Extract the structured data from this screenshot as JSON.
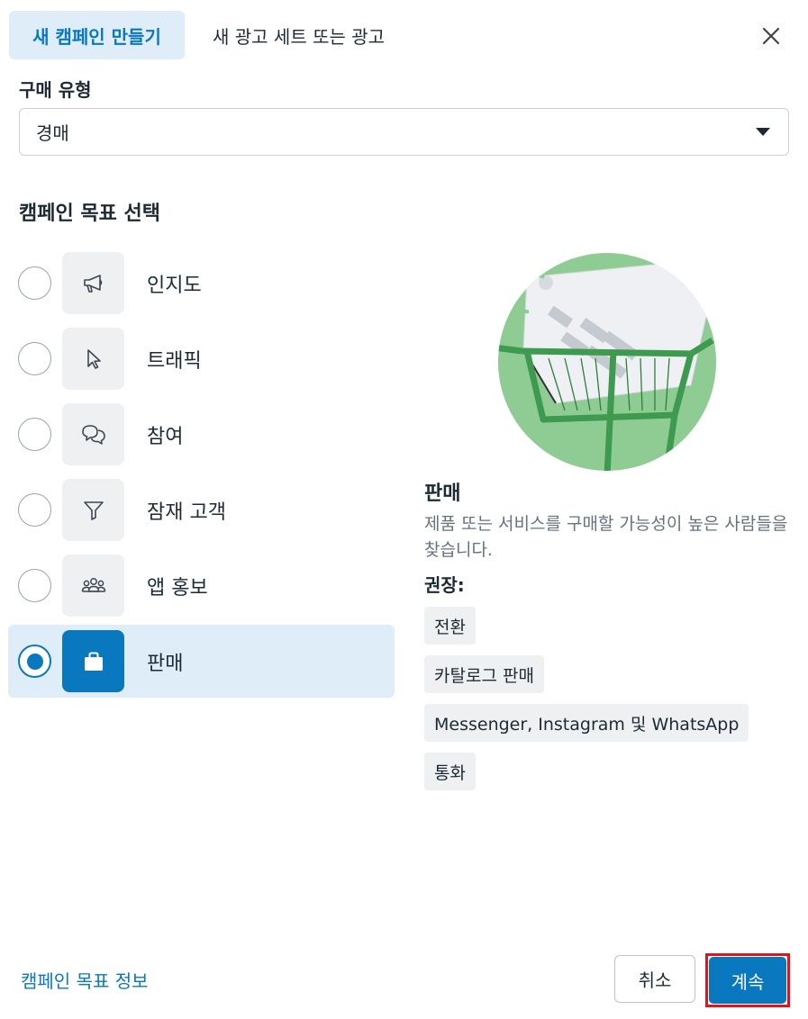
{
  "header": {
    "active_tab": "새 캠페인 만들기",
    "inactive_tab": "새 광고 세트 또는 광고",
    "close_icon": "close-icon"
  },
  "purchase_type": {
    "label": "구매 유형",
    "value": "경매"
  },
  "objective": {
    "heading": "캠페인 목표 선택",
    "items": [
      {
        "label": "인지도",
        "icon": "megaphone-icon",
        "selected": false
      },
      {
        "label": "트래픽",
        "icon": "cursor-icon",
        "selected": false
      },
      {
        "label": "참여",
        "icon": "chat-bubbles-icon",
        "selected": false
      },
      {
        "label": "잠재 고객",
        "icon": "funnel-icon",
        "selected": false
      },
      {
        "label": "앱 홍보",
        "icon": "people-group-icon",
        "selected": false
      },
      {
        "label": "판매",
        "icon": "shopping-bag-icon",
        "selected": true
      }
    ]
  },
  "detail": {
    "title": "판매",
    "description": "제품 또는 서비스를 구매할 가능성이 높은 사람들을 찾습니다.",
    "recommended_label": "권장:",
    "recommended": [
      "전환",
      "카탈로그 판매",
      "Messenger, Instagram 및 WhatsApp",
      "통화"
    ]
  },
  "footer": {
    "info_link": "캠페인 목표 정보",
    "cancel": "취소",
    "continue": "계속"
  },
  "colors": {
    "accent": "#0a78be",
    "selected_bg": "#dfedf9",
    "highlight_border": "#e0141e",
    "illustration_green": "#8fcc94"
  }
}
